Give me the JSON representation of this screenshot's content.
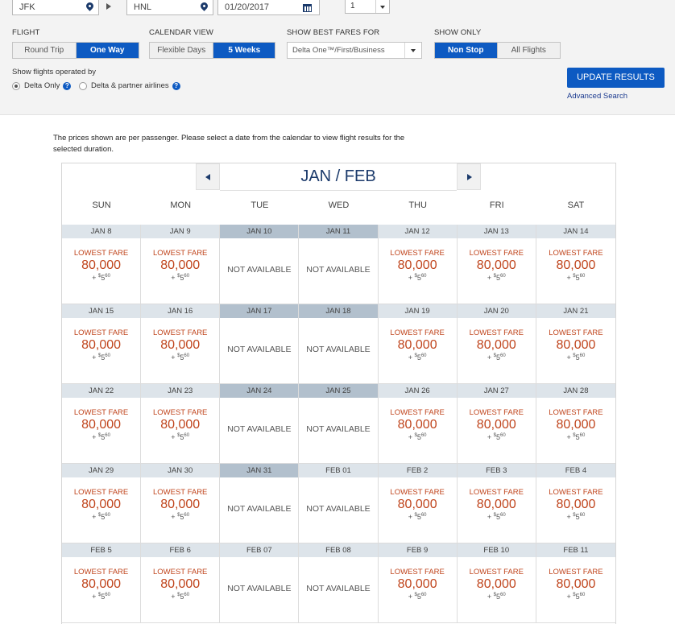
{
  "search": {
    "from": "JFK",
    "to": "HNL",
    "date": "01/20/2017",
    "passengers": "1"
  },
  "flight": {
    "label": "FLIGHT",
    "options": [
      "Round Trip",
      "One Way"
    ],
    "active": 1
  },
  "calendar_view": {
    "label": "CALENDAR VIEW",
    "options": [
      "Flexible Days",
      "5 Weeks"
    ],
    "active": 1
  },
  "best_fares": {
    "label": "SHOW BEST FARES FOR",
    "value": "Delta One™/First/Business"
  },
  "show_only": {
    "label": "SHOW ONLY",
    "options": [
      "Non Stop",
      "All Flights"
    ],
    "active": 0
  },
  "operated_by": {
    "label": "Show flights operated by",
    "options": [
      "Delta Only",
      "Delta & partner airlines"
    ],
    "selected": 0
  },
  "update_button": "UPDATE RESULTS",
  "advanced_search": "Advanced Search",
  "note": "The prices shown are per passenger. Please select a date from the calendar to view flight results for the selected duration.",
  "month_title": "JAN / FEB",
  "days_of_week": [
    "SUN",
    "MON",
    "TUE",
    "WED",
    "THU",
    "FRI",
    "SAT"
  ],
  "fare_label": "LOWEST FARE",
  "fare_miles": "80,000",
  "fare_tax_prefix": "+ ",
  "fare_tax_dollar": "$",
  "fare_tax_amount": "5",
  "fare_tax_cents": "60",
  "not_available": "NOT AVAILABLE",
  "weeks": [
    [
      {
        "date": "JAN 8",
        "available": true
      },
      {
        "date": "JAN 9",
        "available": true
      },
      {
        "date": "JAN 10",
        "available": false,
        "shade": true
      },
      {
        "date": "JAN 11",
        "available": false,
        "shade": true
      },
      {
        "date": "JAN 12",
        "available": true
      },
      {
        "date": "JAN 13",
        "available": true
      },
      {
        "date": "JAN 14",
        "available": true
      }
    ],
    [
      {
        "date": "JAN 15",
        "available": true
      },
      {
        "date": "JAN 16",
        "available": true
      },
      {
        "date": "JAN 17",
        "available": false,
        "shade": true
      },
      {
        "date": "JAN 18",
        "available": false,
        "shade": true
      },
      {
        "date": "JAN 19",
        "available": true
      },
      {
        "date": "JAN 20",
        "available": true
      },
      {
        "date": "JAN 21",
        "available": true
      }
    ],
    [
      {
        "date": "JAN 22",
        "available": true
      },
      {
        "date": "JAN 23",
        "available": true
      },
      {
        "date": "JAN 24",
        "available": false,
        "shade": true
      },
      {
        "date": "JAN 25",
        "available": false,
        "shade": true
      },
      {
        "date": "JAN 26",
        "available": true
      },
      {
        "date": "JAN 27",
        "available": true
      },
      {
        "date": "JAN 28",
        "available": true
      }
    ],
    [
      {
        "date": "JAN 29",
        "available": true
      },
      {
        "date": "JAN 30",
        "available": true
      },
      {
        "date": "JAN 31",
        "available": false,
        "shade": true
      },
      {
        "date": "FEB 01",
        "available": false,
        "shade": false
      },
      {
        "date": "FEB 2",
        "available": true
      },
      {
        "date": "FEB 3",
        "available": true
      },
      {
        "date": "FEB 4",
        "available": true
      }
    ],
    [
      {
        "date": "FEB 5",
        "available": true
      },
      {
        "date": "FEB 6",
        "available": true
      },
      {
        "date": "FEB 07",
        "available": false,
        "shade": false
      },
      {
        "date": "FEB 08",
        "available": false,
        "shade": false
      },
      {
        "date": "FEB 9",
        "available": true
      },
      {
        "date": "FEB 10",
        "available": true
      },
      {
        "date": "FEB 11",
        "available": true
      }
    ]
  ],
  "colors": {
    "primary_blue": "#0d5ac2",
    "navy": "#1b3a6b",
    "fare_orange": "#c0451d",
    "date_header": "#dde4ea",
    "date_header_na": "#b2c0cd"
  }
}
